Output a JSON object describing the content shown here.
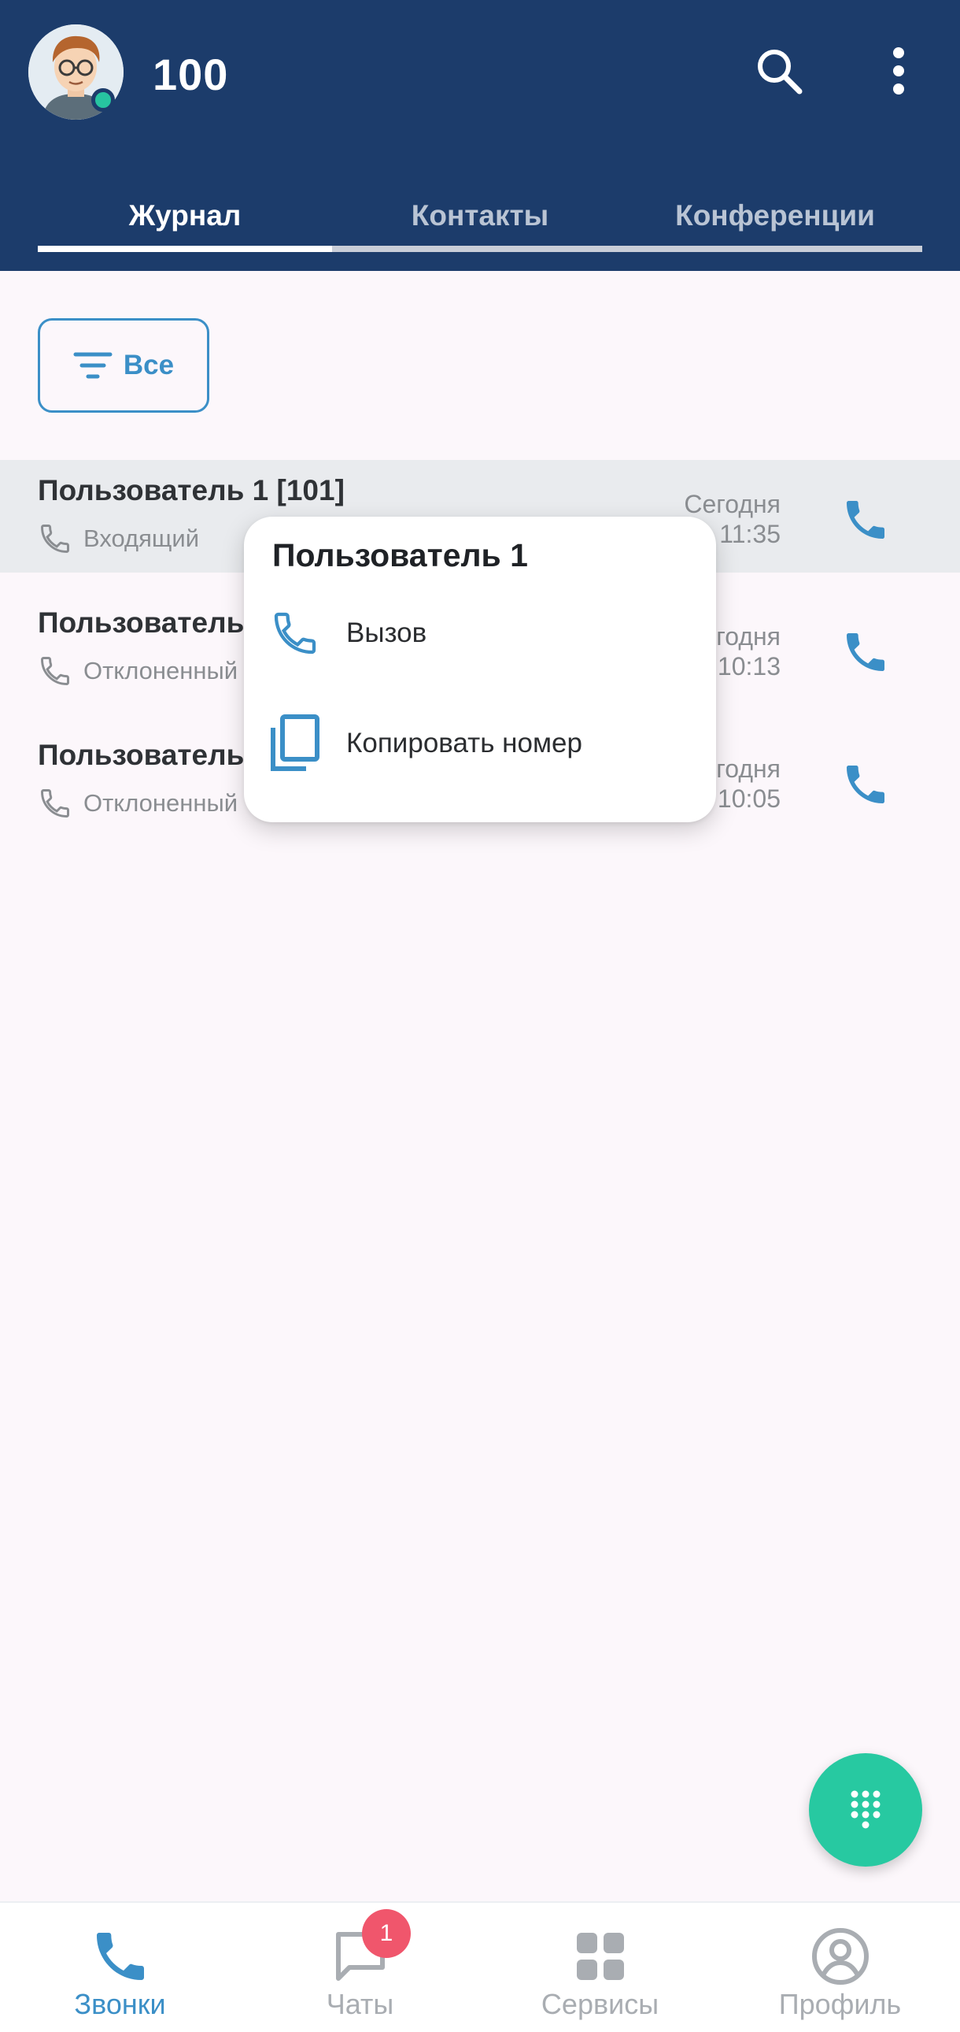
{
  "header": {
    "account_name": "100",
    "tabs": [
      {
        "label": "Журнал",
        "active": true
      },
      {
        "label": "Контакты",
        "active": false
      },
      {
        "label": "Конференции",
        "active": false
      }
    ]
  },
  "filter": {
    "label": "Все",
    "icon": "filter-icon"
  },
  "calls": [
    {
      "name": "Пользователь 1 [101]",
      "type": "Входящий",
      "day": "Сегодня",
      "time": "11:35"
    },
    {
      "name": "Пользователь",
      "type": "Отклоненный",
      "day": "Сегодня",
      "time": "10:13"
    },
    {
      "name": "Пользователь",
      "type": "Отклоненный",
      "day": "Сегодня",
      "time": "10:05"
    }
  ],
  "context_menu": {
    "title": "Пользователь 1",
    "items": [
      {
        "label": "Вызов",
        "icon": "phone-icon"
      },
      {
        "label": "Копировать номер",
        "icon": "copy-icon"
      }
    ]
  },
  "bottom_nav": {
    "items": [
      {
        "label": "Звонки",
        "icon": "phone-icon",
        "active": true
      },
      {
        "label": "Чаты",
        "icon": "chat-icon",
        "badge": "1"
      },
      {
        "label": "Сервисы",
        "icon": "grid-icon"
      },
      {
        "label": "Профиль",
        "icon": "profile-icon"
      }
    ]
  },
  "colors": {
    "header_bg": "#1c3c6b",
    "accent": "#3b8fc7",
    "fab": "#27c9a1",
    "presence": "#27c4a0",
    "badge": "#f0566c"
  }
}
